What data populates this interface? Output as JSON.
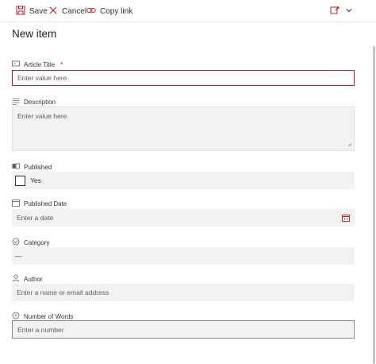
{
  "toolbar": {
    "save_label": "Save",
    "cancel_label": "Cancel",
    "copy_link_label": "Copy link"
  },
  "panel": {
    "title": "New item"
  },
  "fields": {
    "article_title": {
      "label": "Article Title",
      "required_marker": "*",
      "placeholder": "Enter value here"
    },
    "description": {
      "label": "Description",
      "placeholder": "Enter value here"
    },
    "published": {
      "label": "Published",
      "checkbox_label": "Yes",
      "checked": false
    },
    "published_date": {
      "label": "Published Date",
      "placeholder": "Enter a date"
    },
    "category": {
      "label": "Category",
      "value": "—"
    },
    "author": {
      "label": "Author",
      "placeholder": "Enter a name or email address"
    },
    "number_of_words": {
      "label": "Number of Words",
      "placeholder": "Enter a number"
    }
  },
  "colors": {
    "accent": "#a4262c",
    "field_background": "#f3f2f1",
    "text": "#323130"
  },
  "icons": {
    "save": "save-icon",
    "cancel": "close-icon",
    "copy_link": "link-icon",
    "form_view": "form-view-icon",
    "chevron": "chevron-down-icon",
    "calendar": "calendar-icon"
  }
}
